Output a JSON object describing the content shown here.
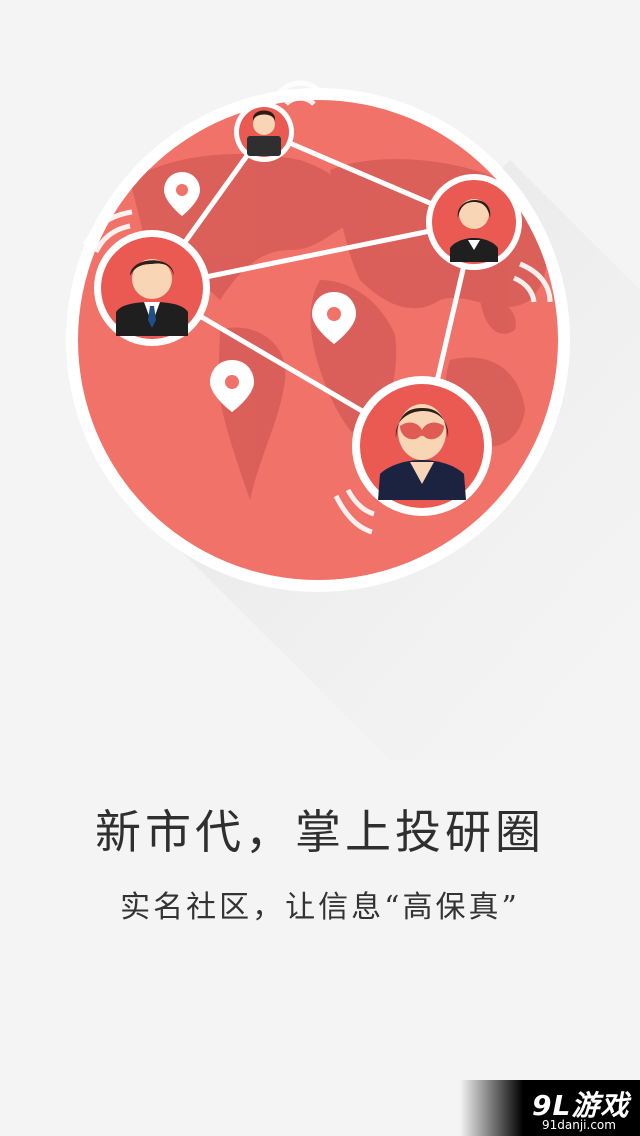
{
  "colors": {
    "background": "#f4f4f4",
    "globe_red": "#f07268",
    "map_dark_red": "#d85e58",
    "outline_white": "#ffffff"
  },
  "hero": {
    "icon_name": "social-globe-network"
  },
  "headline": {
    "title": "新市代，掌上投研圈",
    "subtitle": "实名社区，让信息“高保真”"
  },
  "watermark": {
    "logo": "9L游戏",
    "url": "91danji.com"
  }
}
